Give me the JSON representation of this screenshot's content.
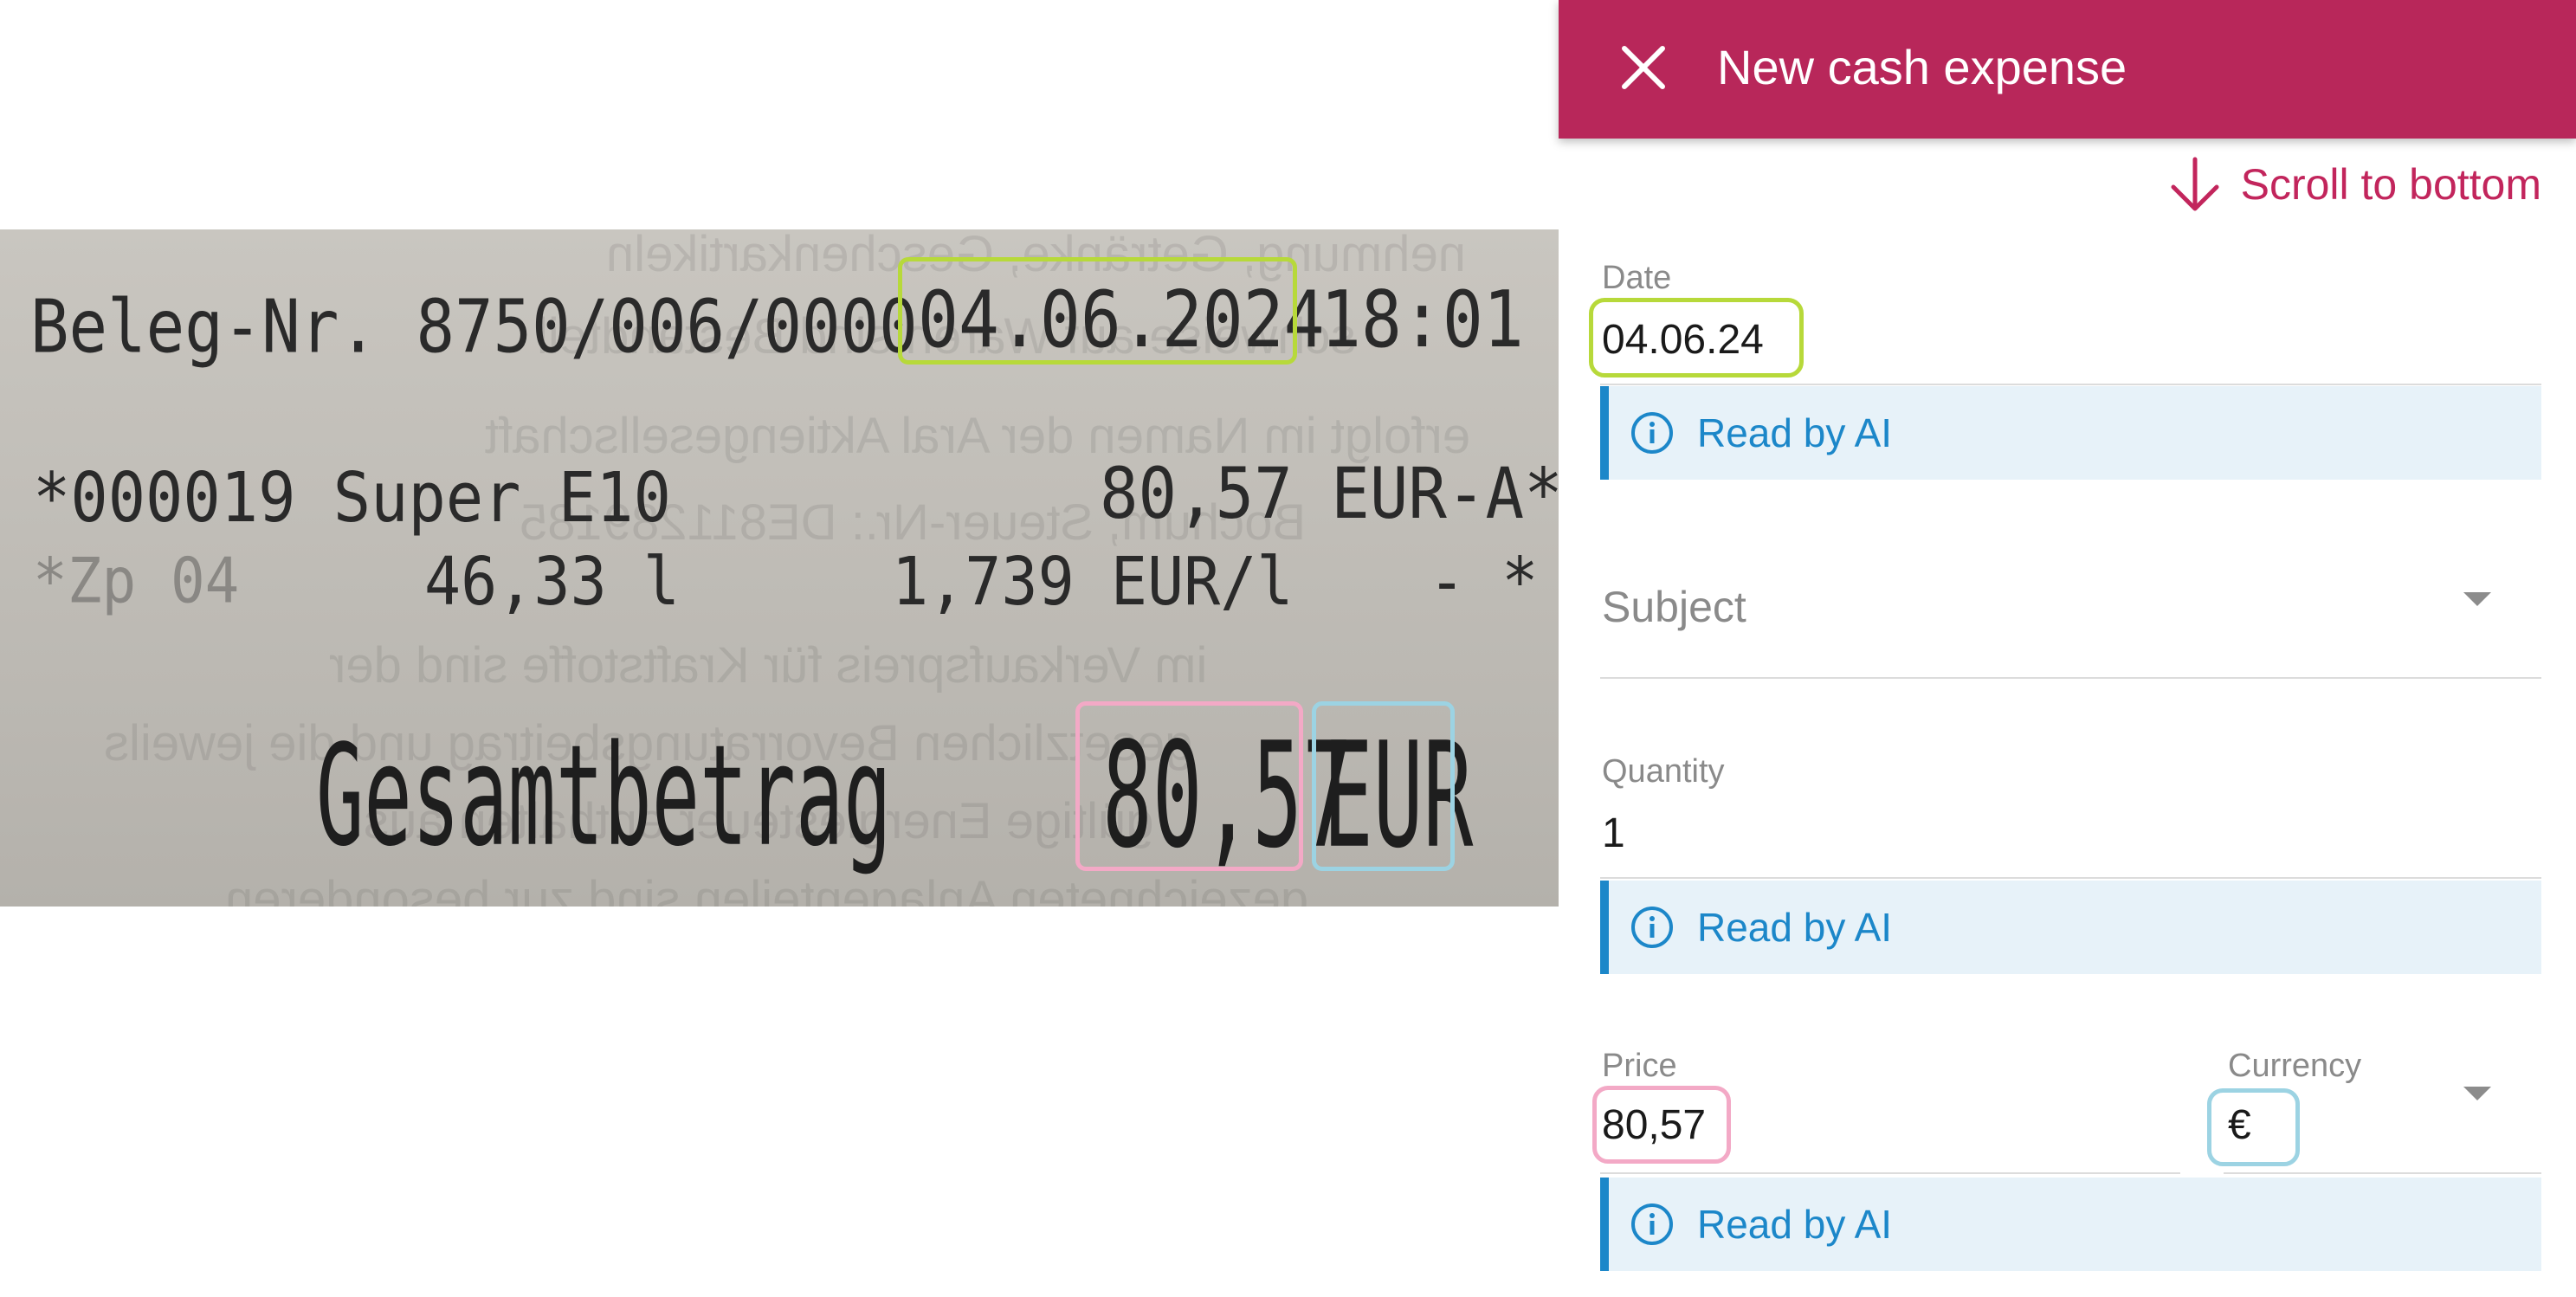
{
  "receipt": {
    "line1_left": "Beleg-Nr. 8750/006/0000",
    "line1_date": "04.06.2024",
    "line1_time": "18:01",
    "line2_left": "*000019 Super E10",
    "line2_amount": "80,57 EUR-A*",
    "line3_left": "*Zp 04",
    "line3_qty": "46,33 l",
    "line3_unit_price": "1,739 EUR/l",
    "line3_right": "- *",
    "total_label": "Gesamtbetrag",
    "total_amount": "80,57",
    "total_currency": "EUR"
  },
  "appbar": {
    "title": "New cash expense",
    "close_icon": "close-icon",
    "background": "#b8275a"
  },
  "scroll_to_bottom": "Scroll to bottom",
  "form": {
    "date": {
      "label": "Date",
      "value": "04.06.24",
      "ai_note": "Read by AI",
      "highlight": "#b7d93a"
    },
    "subject": {
      "placeholder": "Subject"
    },
    "quantity": {
      "label": "Quantity",
      "value": "1",
      "ai_note": "Read by AI"
    },
    "price": {
      "label": "Price",
      "value": "80,57",
      "highlight": "#f3a9c6"
    },
    "currency": {
      "label": "Currency",
      "value": "€",
      "highlight": "#9cd3e3"
    },
    "price_ai_note": "Read by AI"
  },
  "colors": {
    "accent": "#c2255c",
    "ai_blue": "#1c87c9",
    "ai_bg": "#e7f2f9"
  }
}
